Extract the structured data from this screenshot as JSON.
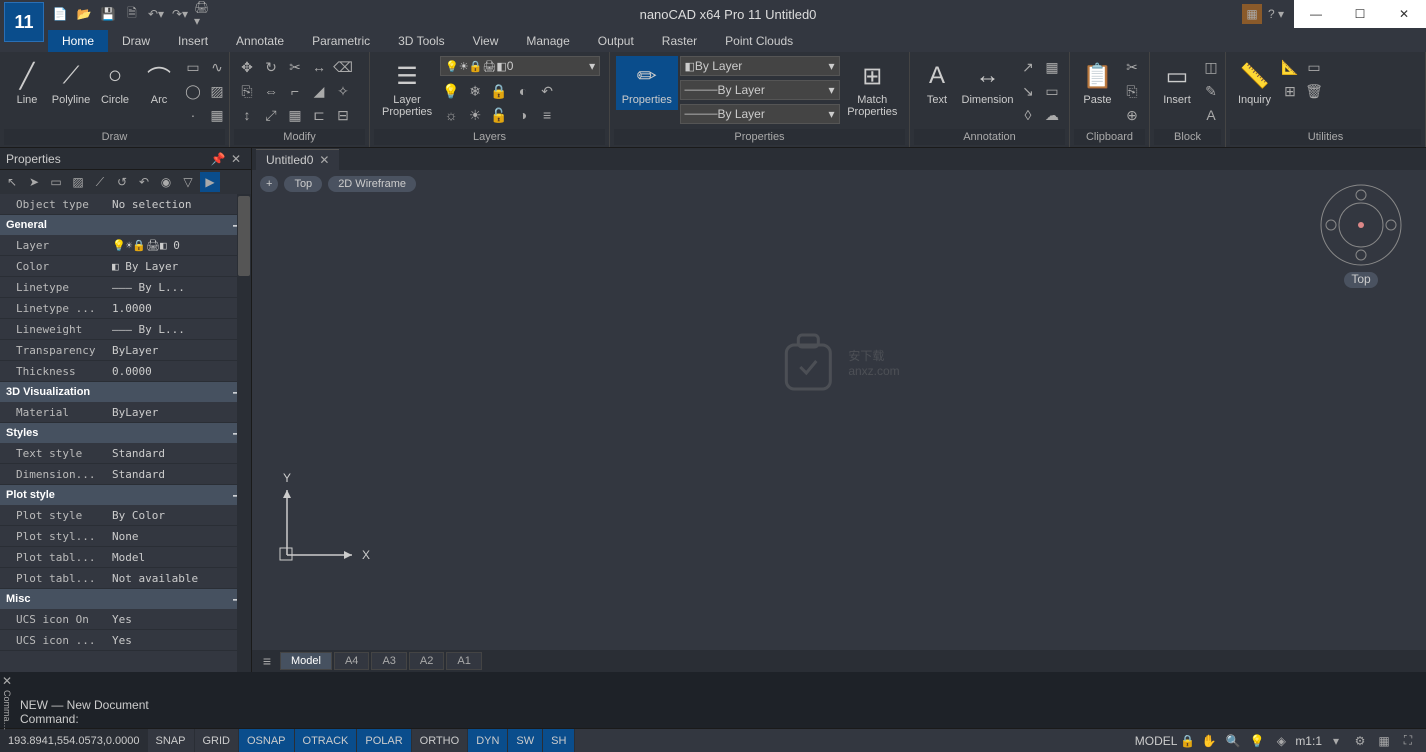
{
  "app": {
    "title": "nanoCAD x64 Pro 11 Untitled0",
    "icon_text": "11"
  },
  "tabs": [
    "Home",
    "View",
    "Draw",
    "Insert",
    "Annotate",
    "Parametric",
    "3D Tools",
    "Manage",
    "Output",
    "Raster",
    "Point Clouds"
  ],
  "ribbon_tabs": [
    {
      "label": "Home",
      "active": true
    },
    {
      "label": "Draw"
    },
    {
      "label": "Insert"
    },
    {
      "label": "Annotate"
    },
    {
      "label": "Parametric"
    },
    {
      "label": "3D Tools"
    },
    {
      "label": "View"
    },
    {
      "label": "Manage"
    },
    {
      "label": "Output"
    },
    {
      "label": "Raster"
    },
    {
      "label": "Point Clouds"
    }
  ],
  "panels": {
    "draw": {
      "label": "Draw",
      "tools": {
        "line": "Line",
        "polyline": "Polyline",
        "circle": "Circle",
        "arc": "Arc"
      }
    },
    "modify": {
      "label": "Modify"
    },
    "layers": {
      "label": "Layers",
      "big": "Layer\nProperties",
      "current": "0"
    },
    "properties": {
      "label": "Properties",
      "big": "Properties",
      "match": "Match\nProperties",
      "bylayer1": "By Layer",
      "bylayer2": "By Layer",
      "bylayer3": "By Layer"
    },
    "annotation": {
      "label": "Annotation",
      "text": "Text",
      "dim": "Dimension"
    },
    "clipboard": {
      "label": "Clipboard",
      "paste": "Paste"
    },
    "block": {
      "label": "Block",
      "insert": "Insert"
    },
    "utilities": {
      "label": "Utilities",
      "inquiry": "Inquiry"
    }
  },
  "properties_panel": {
    "title": "Properties",
    "object_type": {
      "k": "Object type",
      "v": "No selection"
    },
    "groups": [
      {
        "name": "General",
        "rows": [
          {
            "k": "Layer",
            "v": "💡☀🔒🖨◧ 0"
          },
          {
            "k": "Color",
            "v": "◧ By Layer"
          },
          {
            "k": "Linetype",
            "v": "——— By L..."
          },
          {
            "k": "Linetype ...",
            "v": "1.0000"
          },
          {
            "k": "Lineweight",
            "v": "——— By L..."
          },
          {
            "k": "Transparency",
            "v": "ByLayer"
          },
          {
            "k": "Thickness",
            "v": "0.0000"
          }
        ]
      },
      {
        "name": "3D Visualization",
        "rows": [
          {
            "k": "Material",
            "v": "ByLayer"
          }
        ]
      },
      {
        "name": "Styles",
        "rows": [
          {
            "k": "Text style",
            "v": "Standard"
          },
          {
            "k": "Dimension...",
            "v": "Standard"
          }
        ]
      },
      {
        "name": "Plot style",
        "rows": [
          {
            "k": "Plot style",
            "v": "By Color"
          },
          {
            "k": "Plot styl...",
            "v": "None"
          },
          {
            "k": "Plot tabl...",
            "v": "Model"
          },
          {
            "k": "Plot tabl...",
            "v": "Not available"
          }
        ]
      },
      {
        "name": "Misc",
        "rows": [
          {
            "k": "UCS icon On",
            "v": "Yes"
          },
          {
            "k": "UCS icon ...",
            "v": "Yes"
          }
        ]
      }
    ]
  },
  "doc_tab": "Untitled0",
  "view_badges": {
    "plus": "+",
    "top": "Top",
    "style": "2D Wireframe"
  },
  "viewcube_label": "Top",
  "watermark": "安下载\nanxz.com",
  "model_tabs": [
    "Model",
    "A4",
    "A3",
    "A2",
    "A1"
  ],
  "cmd": {
    "line1": "NEW — New Document",
    "prompt": "Command:"
  },
  "status": {
    "coords": "193.8941,554.0573,0.0000",
    "toggles": [
      {
        "t": "SNAP",
        "a": false
      },
      {
        "t": "GRID",
        "a": false
      },
      {
        "t": "OSNAP",
        "a": true
      },
      {
        "t": "OTRACK",
        "a": true
      },
      {
        "t": "POLAR",
        "a": true
      },
      {
        "t": "ORTHO",
        "a": false
      },
      {
        "t": "DYN",
        "a": true
      },
      {
        "t": "SW",
        "a": true
      },
      {
        "t": "SH",
        "a": true
      }
    ],
    "scale": "m1:1"
  }
}
